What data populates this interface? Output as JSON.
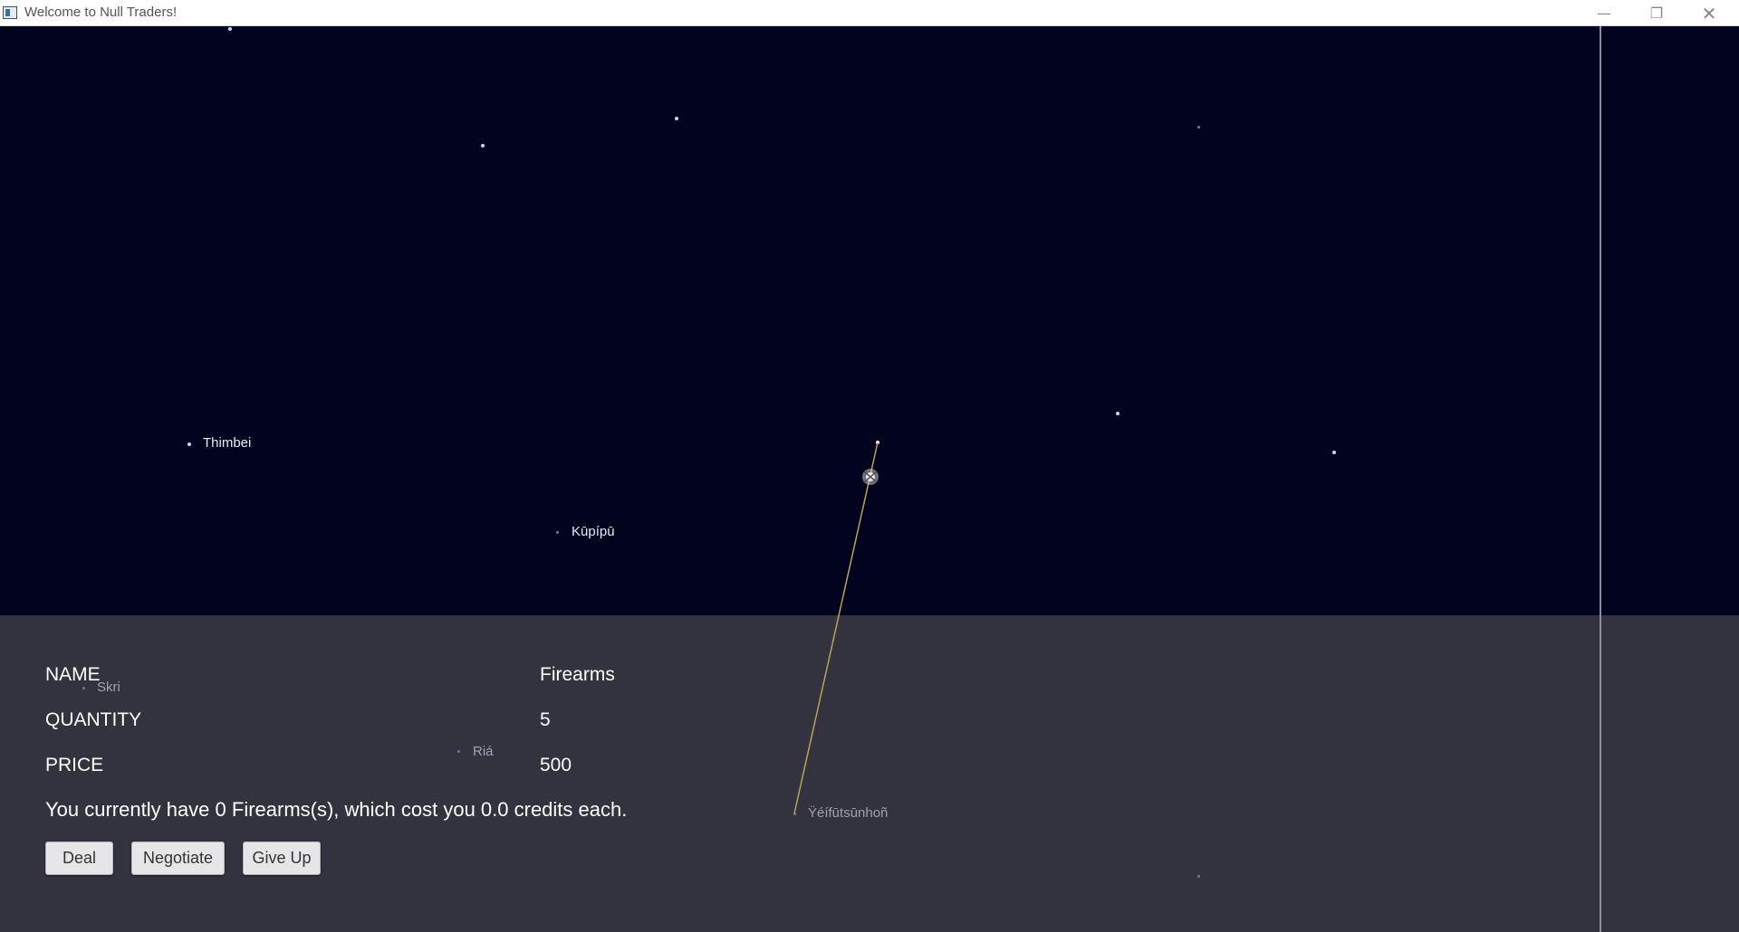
{
  "window": {
    "title": "Welcome to Null Traders!",
    "minimize_icon": "minimize-icon",
    "restore_icon": "restore-icon",
    "close_icon": "close-icon"
  },
  "map": {
    "planets": {
      "thimbei": "Thimbei",
      "kupipu": "Kūpípū",
      "skri": "Skri",
      "ria": "Riá",
      "yeifutsunhon": "Ÿéífūtsūnhoñ"
    },
    "ship_icon": "ship-icon",
    "route_color": "#b6a25a"
  },
  "trade": {
    "rows": [
      {
        "label": "NAME",
        "value": "Firearms"
      },
      {
        "label": "QUANTITY",
        "value": "5"
      },
      {
        "label": "PRICE",
        "value": "500"
      }
    ],
    "info": "You currently have 0 Firearms(s), which cost you 0.0 credits each.",
    "buttons": {
      "deal": "Deal",
      "negotiate": "Negotiate",
      "give_up": "Give Up"
    }
  },
  "colors": {
    "space_bg": "#02031e",
    "panel_bg": "#33333f"
  }
}
